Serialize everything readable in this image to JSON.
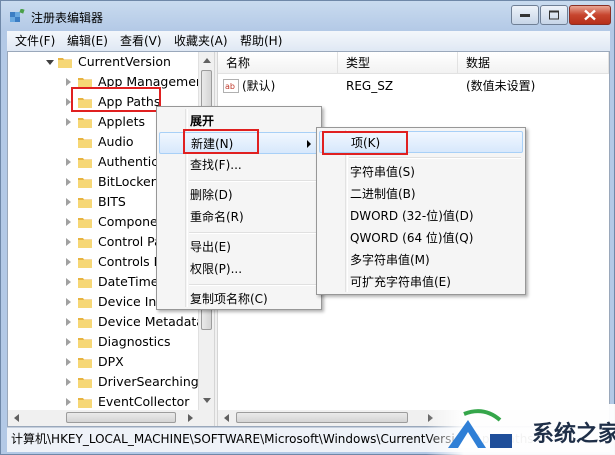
{
  "window": {
    "title": "注册表编辑器"
  },
  "menubar": {
    "items": [
      "文件(F)",
      "编辑(E)",
      "查看(V)",
      "收藏夹(A)",
      "帮助(H)"
    ]
  },
  "tree": {
    "root": "CurrentVersion",
    "items": [
      "App Managemer",
      "App Paths",
      "Applets",
      "Audio",
      "Authenticat",
      "BitLocker",
      "BITS",
      "Compone",
      "Control Pa",
      "Controls F",
      "DateTime",
      "Device Ins",
      "Device Metadata",
      "Diagnostics",
      "DPX",
      "DriverSearching",
      "EventCollector"
    ]
  },
  "list": {
    "columns": [
      "名称",
      "类型",
      "数据"
    ],
    "rows": [
      {
        "name": "(默认)",
        "type": "REG_SZ",
        "data": "(数值未设置)"
      }
    ]
  },
  "context_menu": {
    "items": [
      "展开",
      "新建(N)",
      "查找(F)...",
      "删除(D)",
      "重命名(R)",
      "导出(E)",
      "权限(P)...",
      "复制项名称(C)"
    ]
  },
  "submenu": {
    "items": [
      "项(K)",
      "字符串值(S)",
      "二进制值(B)",
      "DWORD (32-位)值(D)",
      "QWORD (64 位)值(Q)",
      "多字符串值(M)",
      "可扩充字符串值(E)"
    ]
  },
  "statusbar": {
    "path": "计算机\\HKEY_LOCAL_MACHINE\\SOFTWARE\\Microsoft\\Windows\\CurrentVersion\\App Paths"
  },
  "watermark": {
    "text": "系统之家"
  },
  "colors": {
    "highlight_border": "#e02020",
    "menu_hover": "#d7e8fc"
  }
}
